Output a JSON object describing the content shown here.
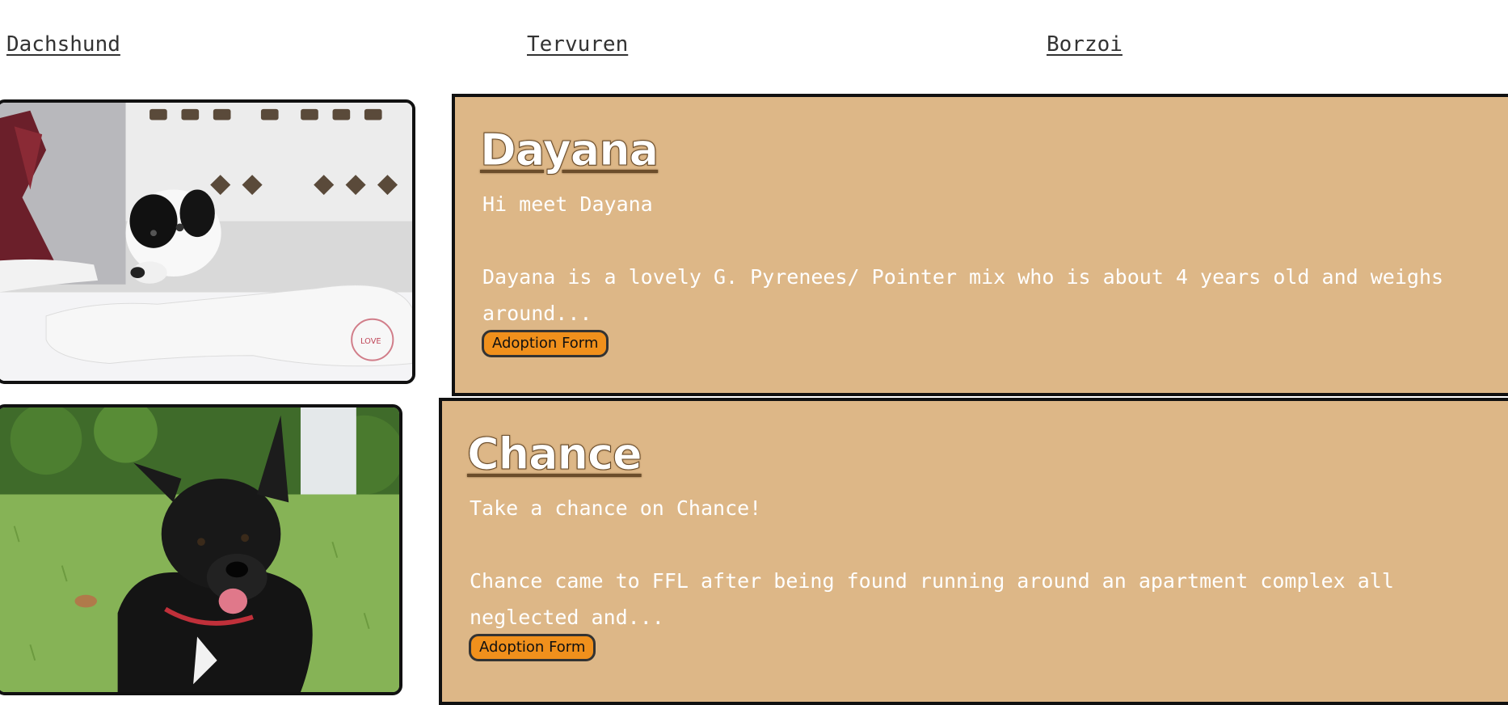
{
  "nav": {
    "links": [
      {
        "label": "Dachshund"
      },
      {
        "label": "Tervuren"
      },
      {
        "label": "Borzoi"
      }
    ]
  },
  "dogs": [
    {
      "name": "Dayana",
      "tagline": "Hi meet Dayana",
      "description": "Dayana is a lovely G. Pyrenees/ Pointer mix who is about 4 years old and weighs around...",
      "button_label": "Adoption Form",
      "photo_icon": "white-dog-photo"
    },
    {
      "name": "Chance",
      "tagline": "Take a chance on Chance!",
      "description": "Chance came to FFL after being found running around an apartment complex all neglected and...",
      "button_label": "Adoption Form",
      "photo_icon": "black-dog-photo"
    }
  ],
  "colors": {
    "card_bg": "#ddb787",
    "button_bg": "#f0901c",
    "border": "#111111",
    "nav_text": "#333333"
  }
}
